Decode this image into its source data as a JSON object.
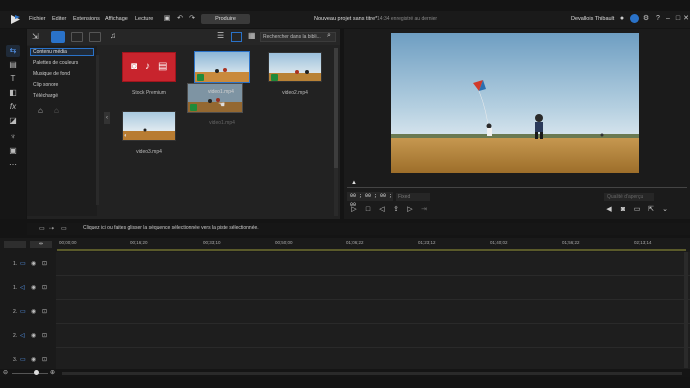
{
  "app": {
    "menu": [
      "Fichier",
      "Editer",
      "Extensions",
      "Affichage",
      "Lecture"
    ],
    "produce_label": "Produire",
    "project_title": "Nouveau projet sans titre*",
    "save_status": "14:34 enregistré au dernier",
    "user_name": "Devallois Thibault"
  },
  "library": {
    "search_placeholder": "Rechercher dans la bibli...",
    "categories": [
      "Contenu média",
      "Palettes de couleurs",
      "Musique de fond",
      "Clip sonore",
      "Téléchargé"
    ],
    "items": [
      {
        "label": "Stock Premium"
      },
      {
        "label": "video1.mp4"
      },
      {
        "label": "video2.mp4"
      },
      {
        "label": "video3.mp4"
      }
    ],
    "drag_label": "video1.mp4",
    "ghost_label": "video1.mp4"
  },
  "preview": {
    "timecode": "00 ; 00 ; 00 ; 00",
    "zoom": "Fixed",
    "dropdown": "Qualité d'aperçu"
  },
  "hint": "Cliquez ici ou faites glisser la séquence sélectionnée vers la piste sélectionnée.",
  "timeline": {
    "ruler": [
      "00;00;00",
      "00;16;20",
      "00;33;10",
      "00;50;00",
      "01;06;22",
      "01;23;12",
      "01;40;02",
      "01;56;22",
      "02;13;14"
    ],
    "tracks": [
      "1.",
      "1.",
      "2.",
      "2.",
      "3."
    ]
  },
  "colors": {
    "accent": "#2a72c8",
    "stock_red": "#c8242d"
  }
}
